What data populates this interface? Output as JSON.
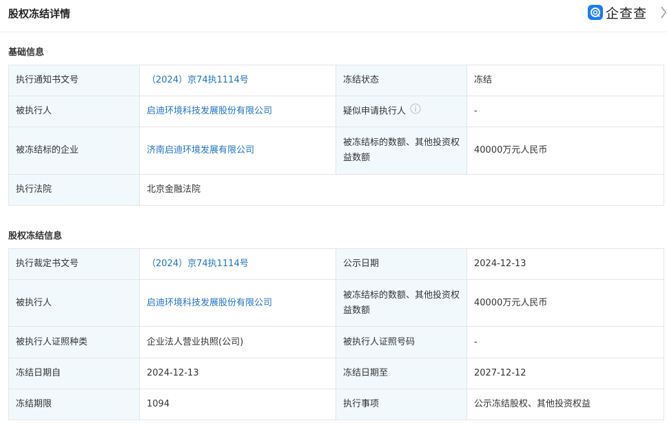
{
  "header": {
    "title": "股权冻结详情",
    "brand": "企查查",
    "brand_icon": "qichacha-logo-icon",
    "chevron_icon": "chevron-right-icon"
  },
  "basic": {
    "title": "基础信息",
    "execution_notice_no_label": "执行通知书文号",
    "execution_notice_no": "（2024）京74执1114号",
    "freeze_status_label": "冻结状态",
    "freeze_status": "冻结",
    "executed_person_label": "被执行人",
    "executed_person": "启迪环境科技发展股份有限公司",
    "suspected_applicant_label": "疑似申请执行人",
    "suspected_applicant": "-",
    "frozen_company_label": "被冻结标的企业",
    "frozen_company": "济南启迪环境发展有限公司",
    "frozen_amount_label": "被冻结标的数额、其他投资权益数额",
    "frozen_amount": "40000万元人民币",
    "court_label": "执行法院",
    "court": "北京金融法院"
  },
  "freeze": {
    "title": "股权冻结信息",
    "ruling_no_label": "执行裁定书文号",
    "ruling_no": "（2024）京74执1114号",
    "publicity_date_label": "公示日期",
    "publicity_date": "2024-12-13",
    "executed_person_label": "被执行人",
    "executed_person": "启迪环境科技发展股份有限公司",
    "frozen_amount_label": "被冻结标的数额、其他投资权益数额",
    "frozen_amount": "40000万元人民币",
    "cert_type_label": "被执行人证照种类",
    "cert_type": "企业法人营业执照(公司)",
    "cert_no_label": "被执行人证照号码",
    "cert_no": "-",
    "freeze_from_label": "冻结日期自",
    "freeze_from": "2024-12-13",
    "freeze_to_label": "冻结日期至",
    "freeze_to": "2027-12-12",
    "period_label": "冻结期限",
    "period": "1094",
    "matter_label": "执行事项",
    "matter": "公示冻结股权、其他投资权益"
  }
}
